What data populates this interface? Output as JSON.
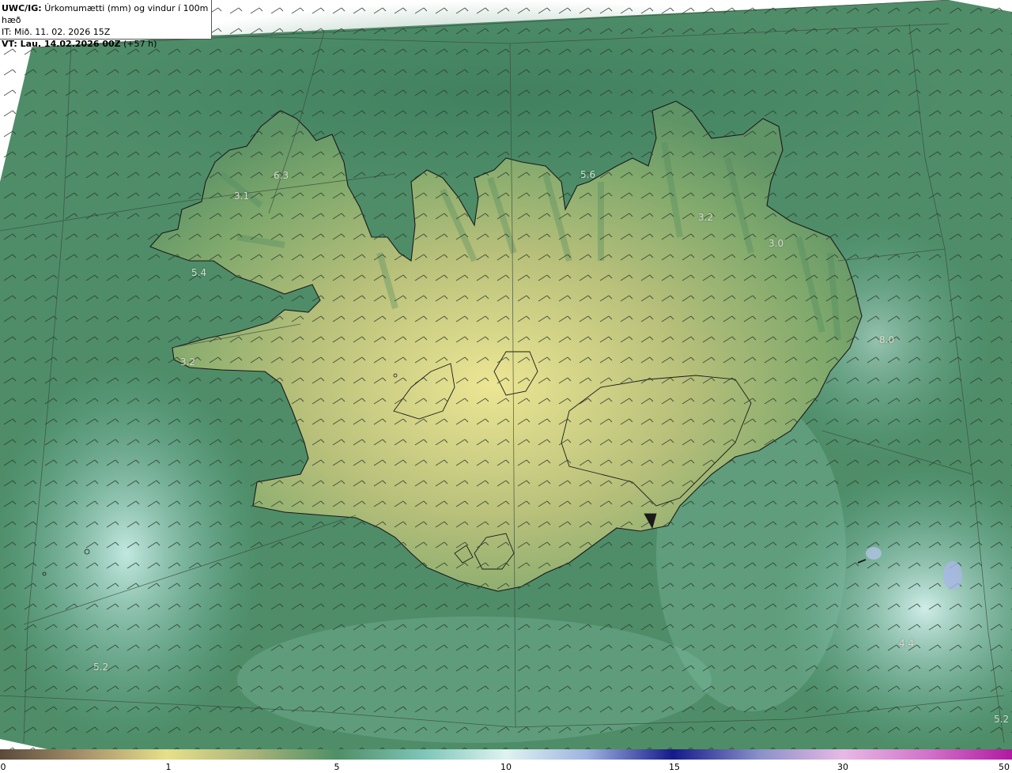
{
  "header": {
    "model": "UWC/IG:",
    "description": "Úrkomumætti (mm) og vindur í 100m hæð",
    "initial_time": "IT: Mið. 11. 02. 2026 15Z",
    "valid_prefix": "VT: Lau. 14.02.2026 00Z",
    "valid_offset": "(+57 h)"
  },
  "value_labels": [
    {
      "id": "v1",
      "text": "6.3"
    },
    {
      "id": "v2",
      "text": "3.1"
    },
    {
      "id": "v3",
      "text": "5.4"
    },
    {
      "id": "v4",
      "text": "3.2"
    },
    {
      "id": "v5",
      "text": "5.6"
    },
    {
      "id": "v6",
      "text": "3.2"
    },
    {
      "id": "v7",
      "text": "3.0"
    },
    {
      "id": "v8",
      "text": "8.0"
    },
    {
      "id": "v9",
      "text": "4.4"
    },
    {
      "id": "v10",
      "text": "5.2"
    },
    {
      "id": "v11",
      "text": "5.2"
    }
  ],
  "colorbar": {
    "ticks": [
      "0",
      "1",
      "5",
      "10",
      "15",
      "30",
      "50"
    ],
    "colors": [
      "#5a4a3a",
      "#a58f6a",
      "#e6e08a",
      "#4f8f66",
      "#7fc6ba",
      "#dff3f1",
      "#9fb3e0",
      "#151a8a",
      "#8a90c8",
      "#e8b9e6",
      "#b01aa0"
    ]
  }
}
